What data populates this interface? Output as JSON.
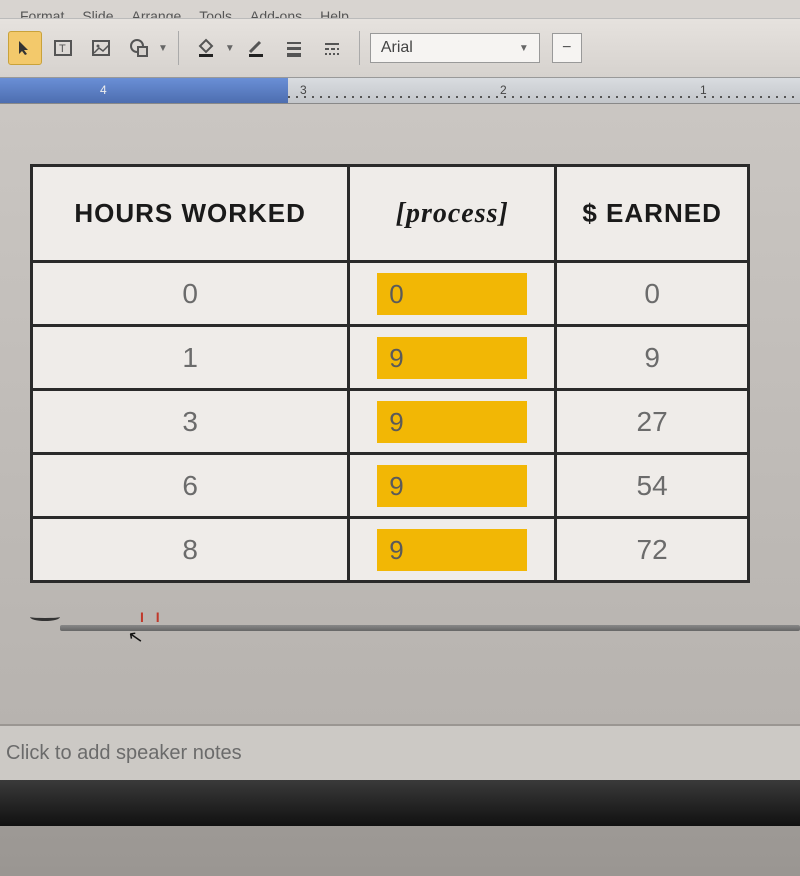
{
  "menubar": {
    "items": [
      "Format",
      "Slide",
      "Arrange",
      "Tools",
      "Add-ons",
      "Help"
    ]
  },
  "toolbar": {
    "font_name": "Arial"
  },
  "ruler": {
    "marks": [
      "4",
      "3",
      "2",
      "1"
    ]
  },
  "table": {
    "headers": {
      "col1": "HOURS WORKED",
      "col2": "[process]",
      "col3": "$ EARNED"
    },
    "rows": [
      {
        "hours": "0",
        "process": "0",
        "earned": "0"
      },
      {
        "hours": "1",
        "process": "9",
        "earned": "9"
      },
      {
        "hours": "3",
        "process": "9",
        "earned": "27"
      },
      {
        "hours": "6",
        "process": "9",
        "earned": "54"
      },
      {
        "hours": "8",
        "process": "9",
        "earned": "72"
      }
    ]
  },
  "notes": {
    "placeholder": "Click to add speaker notes"
  },
  "scrub": {
    "red_marks": "I I"
  }
}
